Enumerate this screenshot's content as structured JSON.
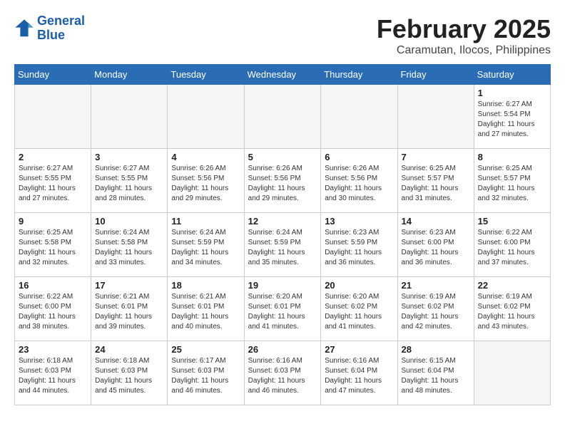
{
  "header": {
    "logo_line1": "General",
    "logo_line2": "Blue",
    "month": "February 2025",
    "location": "Caramutan, Ilocos, Philippines"
  },
  "weekdays": [
    "Sunday",
    "Monday",
    "Tuesday",
    "Wednesday",
    "Thursday",
    "Friday",
    "Saturday"
  ],
  "weeks": [
    [
      {
        "day": "",
        "info": ""
      },
      {
        "day": "",
        "info": ""
      },
      {
        "day": "",
        "info": ""
      },
      {
        "day": "",
        "info": ""
      },
      {
        "day": "",
        "info": ""
      },
      {
        "day": "",
        "info": ""
      },
      {
        "day": "1",
        "info": "Sunrise: 6:27 AM\nSunset: 5:54 PM\nDaylight: 11 hours and 27 minutes."
      }
    ],
    [
      {
        "day": "2",
        "info": "Sunrise: 6:27 AM\nSunset: 5:55 PM\nDaylight: 11 hours and 27 minutes."
      },
      {
        "day": "3",
        "info": "Sunrise: 6:27 AM\nSunset: 5:55 PM\nDaylight: 11 hours and 28 minutes."
      },
      {
        "day": "4",
        "info": "Sunrise: 6:26 AM\nSunset: 5:56 PM\nDaylight: 11 hours and 29 minutes."
      },
      {
        "day": "5",
        "info": "Sunrise: 6:26 AM\nSunset: 5:56 PM\nDaylight: 11 hours and 29 minutes."
      },
      {
        "day": "6",
        "info": "Sunrise: 6:26 AM\nSunset: 5:56 PM\nDaylight: 11 hours and 30 minutes."
      },
      {
        "day": "7",
        "info": "Sunrise: 6:25 AM\nSunset: 5:57 PM\nDaylight: 11 hours and 31 minutes."
      },
      {
        "day": "8",
        "info": "Sunrise: 6:25 AM\nSunset: 5:57 PM\nDaylight: 11 hours and 32 minutes."
      }
    ],
    [
      {
        "day": "9",
        "info": "Sunrise: 6:25 AM\nSunset: 5:58 PM\nDaylight: 11 hours and 32 minutes."
      },
      {
        "day": "10",
        "info": "Sunrise: 6:24 AM\nSunset: 5:58 PM\nDaylight: 11 hours and 33 minutes."
      },
      {
        "day": "11",
        "info": "Sunrise: 6:24 AM\nSunset: 5:59 PM\nDaylight: 11 hours and 34 minutes."
      },
      {
        "day": "12",
        "info": "Sunrise: 6:24 AM\nSunset: 5:59 PM\nDaylight: 11 hours and 35 minutes."
      },
      {
        "day": "13",
        "info": "Sunrise: 6:23 AM\nSunset: 5:59 PM\nDaylight: 11 hours and 36 minutes."
      },
      {
        "day": "14",
        "info": "Sunrise: 6:23 AM\nSunset: 6:00 PM\nDaylight: 11 hours and 36 minutes."
      },
      {
        "day": "15",
        "info": "Sunrise: 6:22 AM\nSunset: 6:00 PM\nDaylight: 11 hours and 37 minutes."
      }
    ],
    [
      {
        "day": "16",
        "info": "Sunrise: 6:22 AM\nSunset: 6:00 PM\nDaylight: 11 hours and 38 minutes."
      },
      {
        "day": "17",
        "info": "Sunrise: 6:21 AM\nSunset: 6:01 PM\nDaylight: 11 hours and 39 minutes."
      },
      {
        "day": "18",
        "info": "Sunrise: 6:21 AM\nSunset: 6:01 PM\nDaylight: 11 hours and 40 minutes."
      },
      {
        "day": "19",
        "info": "Sunrise: 6:20 AM\nSunset: 6:01 PM\nDaylight: 11 hours and 41 minutes."
      },
      {
        "day": "20",
        "info": "Sunrise: 6:20 AM\nSunset: 6:02 PM\nDaylight: 11 hours and 41 minutes."
      },
      {
        "day": "21",
        "info": "Sunrise: 6:19 AM\nSunset: 6:02 PM\nDaylight: 11 hours and 42 minutes."
      },
      {
        "day": "22",
        "info": "Sunrise: 6:19 AM\nSunset: 6:02 PM\nDaylight: 11 hours and 43 minutes."
      }
    ],
    [
      {
        "day": "23",
        "info": "Sunrise: 6:18 AM\nSunset: 6:03 PM\nDaylight: 11 hours and 44 minutes."
      },
      {
        "day": "24",
        "info": "Sunrise: 6:18 AM\nSunset: 6:03 PM\nDaylight: 11 hours and 45 minutes."
      },
      {
        "day": "25",
        "info": "Sunrise: 6:17 AM\nSunset: 6:03 PM\nDaylight: 11 hours and 46 minutes."
      },
      {
        "day": "26",
        "info": "Sunrise: 6:16 AM\nSunset: 6:03 PM\nDaylight: 11 hours and 46 minutes."
      },
      {
        "day": "27",
        "info": "Sunrise: 6:16 AM\nSunset: 6:04 PM\nDaylight: 11 hours and 47 minutes."
      },
      {
        "day": "28",
        "info": "Sunrise: 6:15 AM\nSunset: 6:04 PM\nDaylight: 11 hours and 48 minutes."
      },
      {
        "day": "",
        "info": ""
      }
    ]
  ]
}
